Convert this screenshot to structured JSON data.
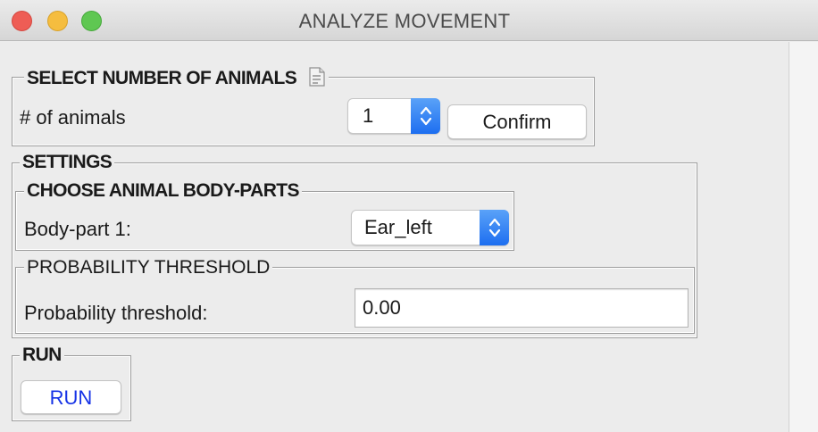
{
  "window": {
    "title": "ANALYZE MOVEMENT"
  },
  "select_animals": {
    "legend": "SELECT NUMBER OF ANIMALS",
    "info_icon": "document-icon",
    "label": "# of animals",
    "selected": "1",
    "confirm_label": "Confirm"
  },
  "settings": {
    "legend": "SETTINGS",
    "bodyparts": {
      "legend": "CHOOSE ANIMAL BODY-PARTS",
      "label": "Body-part 1:",
      "selected": "Ear_left"
    },
    "probability": {
      "legend": "PROBABILITY THRESHOLD",
      "label": "Probability threshold:",
      "value": "0.00"
    }
  },
  "run": {
    "legend": "RUN",
    "button_label": "RUN",
    "button_color": "#1532e6"
  },
  "colors": {
    "traffic_close": "#ee5d55",
    "traffic_minimize": "#f5bd3f",
    "traffic_maximize": "#5fc752",
    "popup_accent": "#1d6ef0"
  }
}
